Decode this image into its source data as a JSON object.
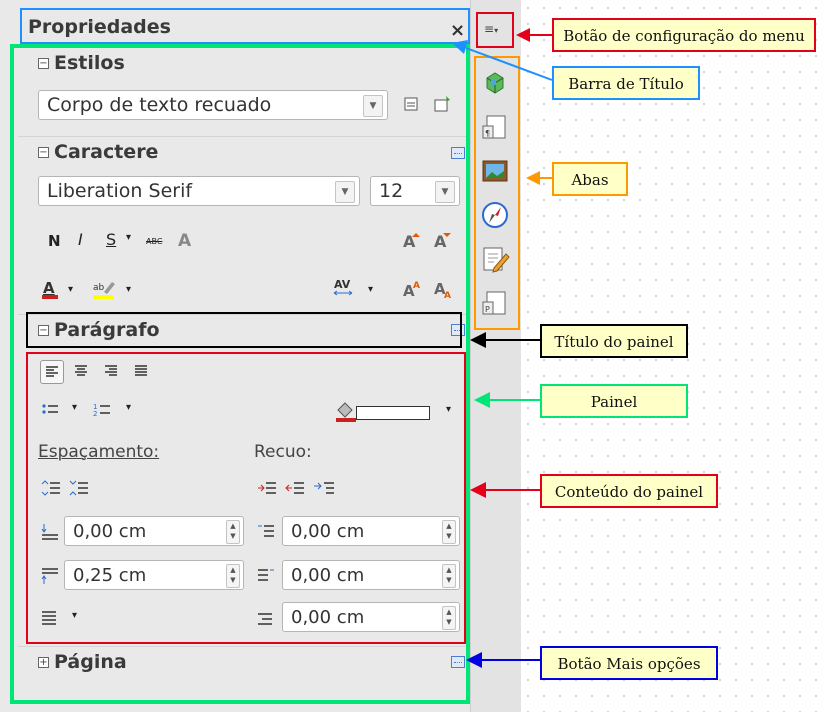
{
  "sidebar": {
    "title": "Propriedades",
    "close_glyph": "×",
    "sections": {
      "estilos": {
        "label": "Estilos",
        "style_value": "Corpo de texto recuado"
      },
      "caractere": {
        "label": "Caractere",
        "font_name": "Liberation Serif",
        "font_size": "12",
        "bold": "N",
        "italic": "I",
        "underline": "S",
        "strike": "ABC",
        "shadow": "A"
      },
      "paragrafo": {
        "label": "Parágrafo",
        "spacing_label": "Espaçamento:",
        "indent_label": "Recuo:",
        "above_value": "0,00 cm",
        "below_value": "0,25 cm",
        "indent_before": "0,00 cm",
        "indent_after": "0,00 cm",
        "first_line": "0,00 cm"
      },
      "pagina": {
        "label": "Página"
      }
    }
  },
  "tabs": [
    "properties-tab",
    "styles-tab",
    "gallery-tab",
    "navigator-tab",
    "manage-changes-tab",
    "page-tab"
  ],
  "annotations": {
    "menu_config": "Botão de configuração do menu",
    "title_bar": "Barra de Título",
    "tabs": "Abas",
    "panel_title": "Título do painel",
    "panel": "Painel",
    "panel_content": "Conteúdo do painel",
    "more_options": "Botão Mais opções"
  },
  "colors": {
    "red": "#e4001b",
    "blue": "#1e90ff",
    "orange": "#ff9900",
    "green": "#00e676",
    "black": "#000000",
    "darkblue": "#0000e0",
    "callout_bg": "#ffffc8"
  }
}
